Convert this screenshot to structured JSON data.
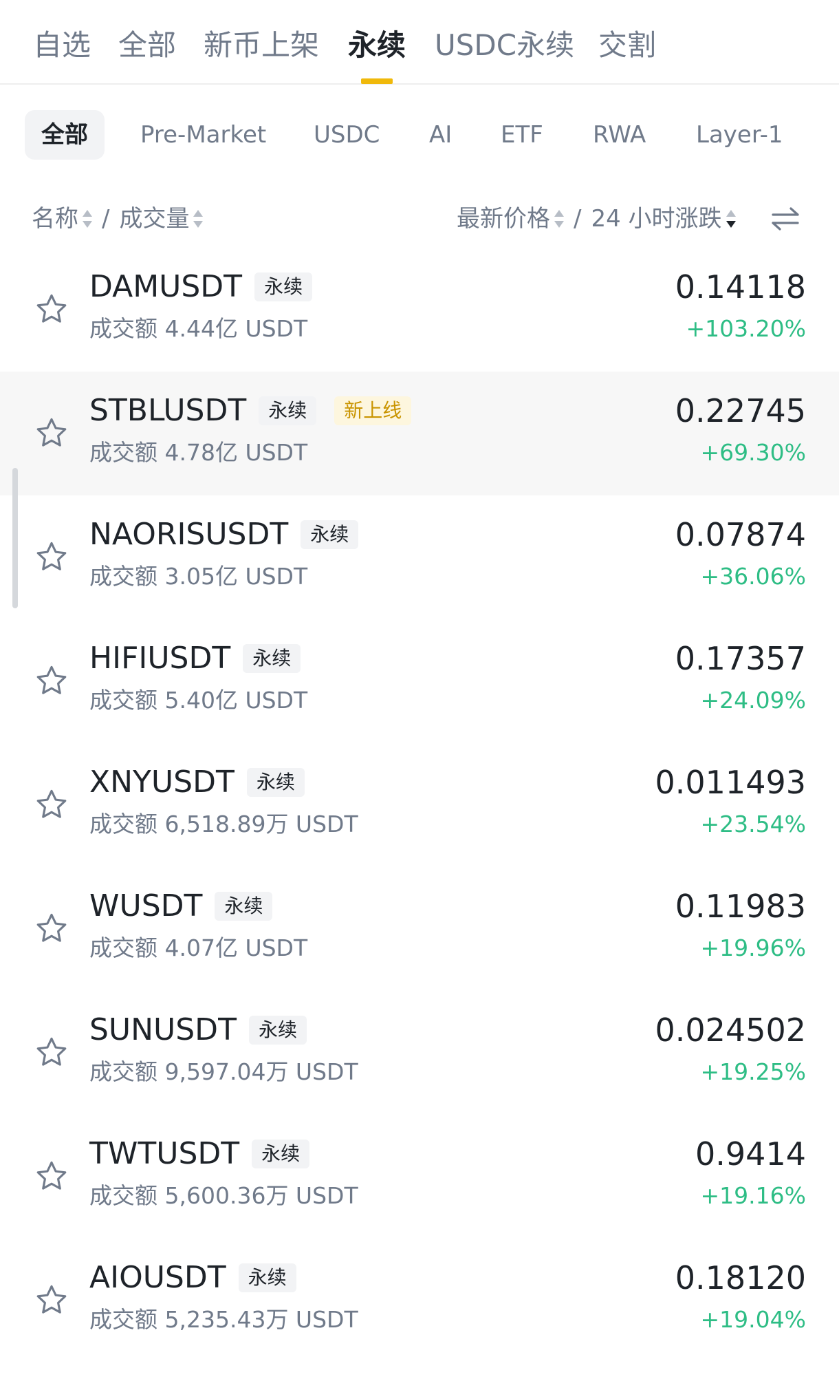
{
  "top_tabs": [
    {
      "label": "自选"
    },
    {
      "label": "全部"
    },
    {
      "label": "新币上架"
    },
    {
      "label": "永续",
      "active": true
    },
    {
      "label": "USDC永续"
    },
    {
      "label": "交割"
    }
  ],
  "chips": [
    {
      "label": "全部",
      "active": true
    },
    {
      "label": "Pre-Market"
    },
    {
      "label": "USDC"
    },
    {
      "label": "AI"
    },
    {
      "label": "ETF"
    },
    {
      "label": "RWA"
    },
    {
      "label": "Layer-1"
    }
  ],
  "header": {
    "name_label": "名称",
    "separator": "/",
    "volume_label": "成交量",
    "price_label": "最新价格",
    "change_label": "24 小时涨跌"
  },
  "colors": {
    "accent": "#f0b90b",
    "positive": "#2ebd85",
    "new_tag_text": "#c99400"
  },
  "rows": [
    {
      "symbol": "DAMUSDT",
      "tag": "永续",
      "volume": "成交额 4.44亿 USDT",
      "price": "0.14118",
      "change": "+103.20%"
    },
    {
      "symbol": "STBLUSDT",
      "tag": "永续",
      "new_tag": "新上线",
      "volume": "成交额 4.78亿 USDT",
      "price": "0.22745",
      "change": "+69.30%"
    },
    {
      "symbol": "NAORISUSDT",
      "tag": "永续",
      "volume": "成交额 3.05亿 USDT",
      "price": "0.07874",
      "change": "+36.06%"
    },
    {
      "symbol": "HIFIUSDT",
      "tag": "永续",
      "volume": "成交额 5.40亿 USDT",
      "price": "0.17357",
      "change": "+24.09%"
    },
    {
      "symbol": "XNYUSDT",
      "tag": "永续",
      "volume": "成交额 6,518.89万 USDT",
      "price": "0.011493",
      "change": "+23.54%"
    },
    {
      "symbol": "WUSDT",
      "tag": "永续",
      "volume": "成交额 4.07亿 USDT",
      "price": "0.11983",
      "change": "+19.96%"
    },
    {
      "symbol": "SUNUSDT",
      "tag": "永续",
      "volume": "成交额 9,597.04万 USDT",
      "price": "0.024502",
      "change": "+19.25%"
    },
    {
      "symbol": "TWTUSDT",
      "tag": "永续",
      "volume": "成交额 5,600.36万 USDT",
      "price": "0.9414",
      "change": "+19.16%"
    },
    {
      "symbol": "AIOUSDT",
      "tag": "永续",
      "volume": "成交额 5,235.43万 USDT",
      "price": "0.18120",
      "change": "+19.04%"
    }
  ]
}
